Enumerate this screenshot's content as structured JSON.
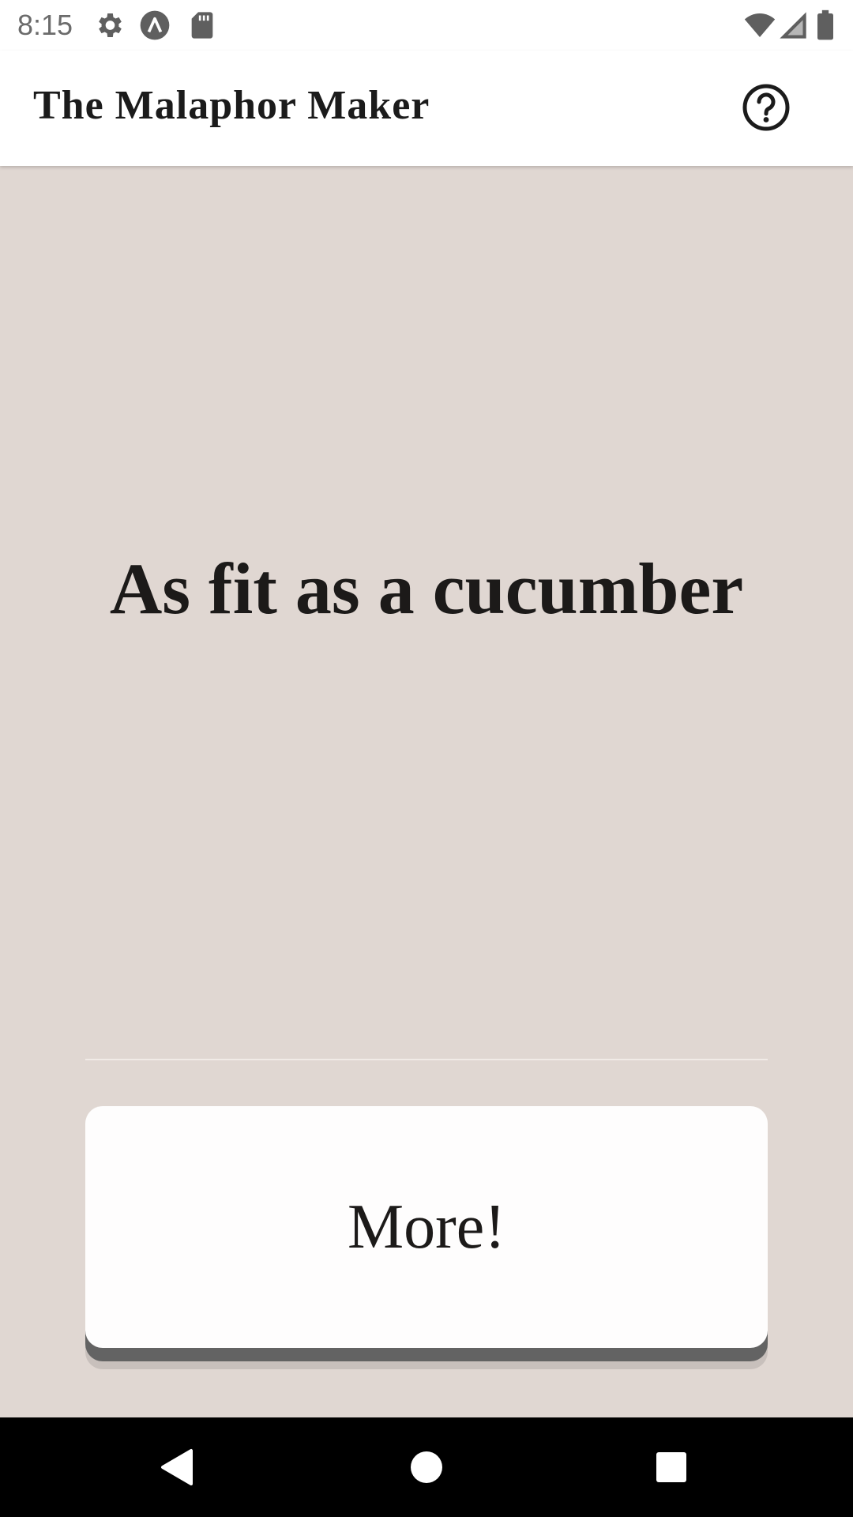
{
  "status_bar": {
    "time": "8:15",
    "left_icons": [
      "gear-icon",
      "app-notification-icon",
      "sd-card-icon"
    ],
    "right_icons": [
      "wifi-icon",
      "cell-signal-icon",
      "battery-icon"
    ]
  },
  "app_bar": {
    "title": "The Malaphor Maker",
    "help_icon": "help-circle-icon"
  },
  "main": {
    "phrase": "As fit as a cucumber",
    "more_button_label": "More!"
  },
  "nav_bar": {
    "buttons": [
      "back-icon",
      "home-icon",
      "recents-icon"
    ]
  },
  "colors": {
    "background": "#e0d7d2",
    "app_bar": "#ffffff",
    "text": "#1c1a19",
    "button": "#fefdfd",
    "button_shadow": "#636363",
    "nav_bar": "#000000"
  }
}
